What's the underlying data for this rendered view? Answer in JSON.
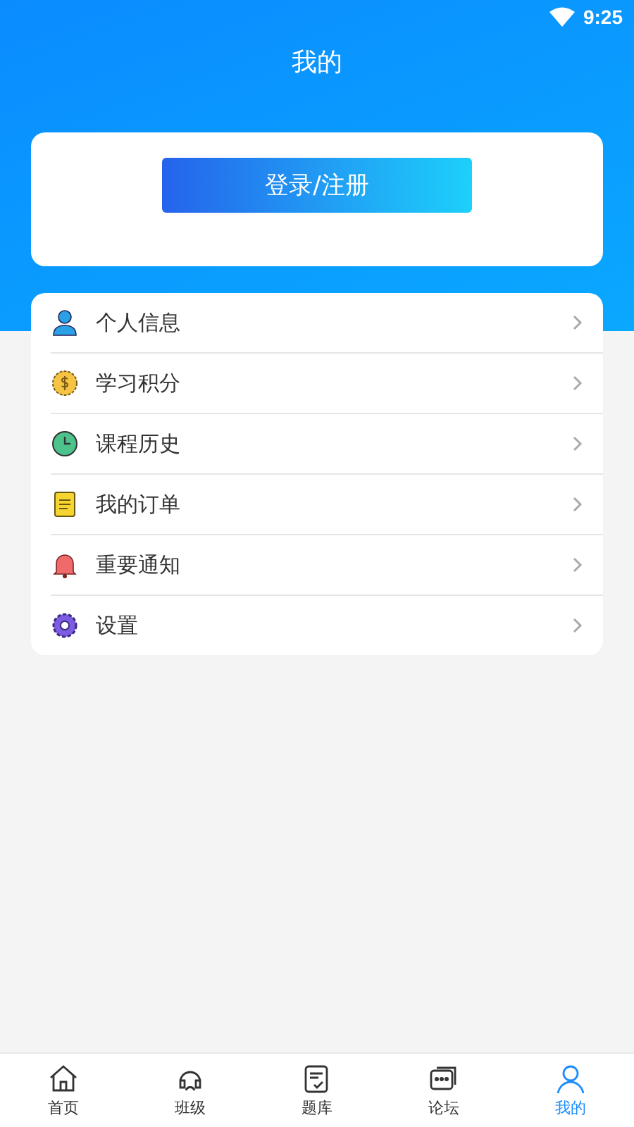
{
  "status_bar": {
    "time": "9:25"
  },
  "header": {
    "title": "我的"
  },
  "login_card": {
    "button": "登录/注册"
  },
  "menu": [
    {
      "kind": "person",
      "label": "个人信息"
    },
    {
      "kind": "coin",
      "label": "学习积分"
    },
    {
      "kind": "clock",
      "label": "课程历史"
    },
    {
      "kind": "note",
      "label": "我的订单"
    },
    {
      "kind": "bell",
      "label": "重要通知"
    },
    {
      "kind": "gear",
      "label": "设置"
    }
  ],
  "bottom_nav": [
    {
      "kind": "home",
      "label": "首页",
      "selected": false
    },
    {
      "kind": "class",
      "label": "班级",
      "selected": false
    },
    {
      "kind": "quiz",
      "label": "题库",
      "selected": false
    },
    {
      "kind": "forum",
      "label": "论坛",
      "selected": false
    },
    {
      "kind": "me",
      "label": "我的",
      "selected": true
    }
  ]
}
